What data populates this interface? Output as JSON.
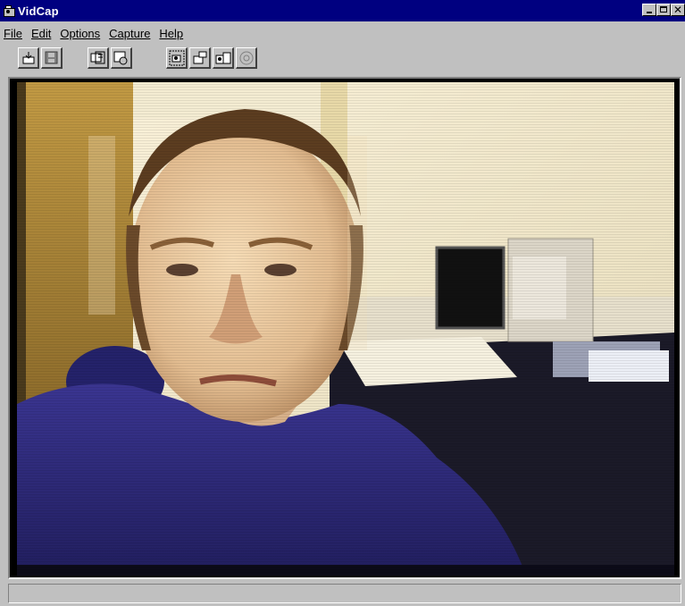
{
  "window": {
    "title": "VidCap"
  },
  "menu": [
    {
      "label": "File",
      "underline": "F"
    },
    {
      "label": "Edit",
      "underline": "E"
    },
    {
      "label": "Options",
      "underline": "O"
    },
    {
      "label": "Capture",
      "underline": "C"
    },
    {
      "label": "Help",
      "underline": "H"
    }
  ],
  "toolbar": {
    "tools": [
      {
        "name": "set-capture-file-icon"
      },
      {
        "name": "save-captured-video-icon"
      },
      {
        "name": "preview-icon"
      },
      {
        "name": "overlay-icon"
      },
      {
        "name": "capture-video-icon"
      },
      {
        "name": "capture-frame-icon"
      },
      {
        "name": "capture-frames-icon"
      },
      {
        "name": "compression-icon"
      }
    ]
  },
  "video": {
    "description_colors": {
      "wall": "#f0e7c8",
      "door": "#b28a3a",
      "shirt": "#2a2a7a",
      "skin": "#e9c9a3"
    }
  },
  "statusbar": {
    "text": ""
  },
  "colors": {
    "titlebar": "#000080",
    "face": "#c0c0c0"
  }
}
